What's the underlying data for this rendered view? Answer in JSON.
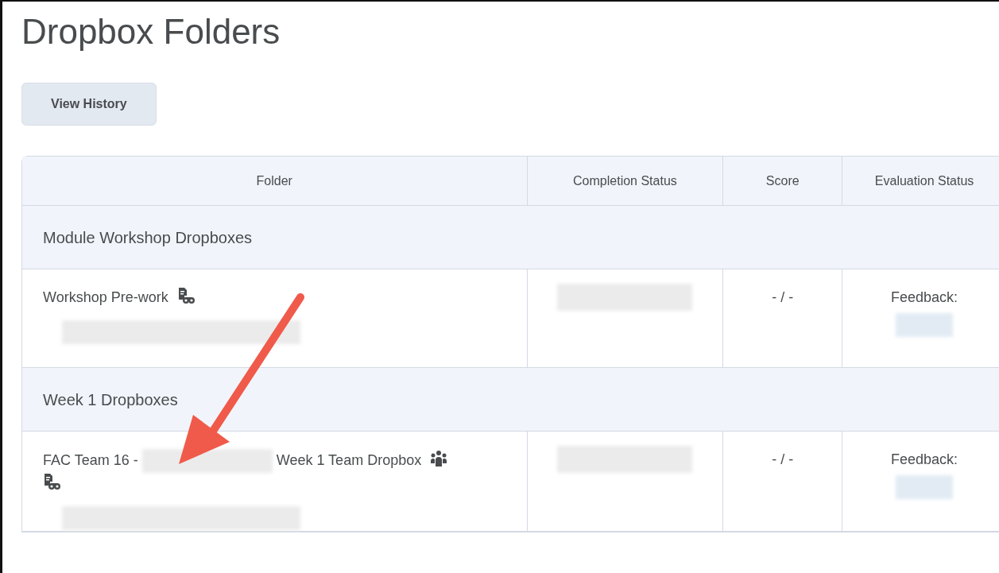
{
  "page": {
    "title": "Dropbox Folders"
  },
  "buttons": [
    {
      "label": "View History"
    }
  ],
  "table": {
    "columns": [
      "Folder",
      "Completion Status",
      "Score",
      "Evaluation Status"
    ],
    "rows": [
      {
        "kind": "group",
        "title": "Module Workshop Dropboxes"
      },
      {
        "kind": "folder",
        "name_parts": [
          {
            "kind": "text",
            "text": "Workshop Pre-work"
          }
        ],
        "group_folder": false,
        "anonymous_marking": true,
        "detail_blurred": true,
        "completion_blurred": true,
        "score": "- / -",
        "evaluation": "Feedback:",
        "feedback_blurred": true
      },
      {
        "kind": "group",
        "title": "Week 1 Dropboxes"
      },
      {
        "kind": "folder",
        "name_parts": [
          {
            "kind": "text",
            "text": "FAC Team 16 -"
          },
          {
            "kind": "blur"
          },
          {
            "kind": "text",
            "text": "Week 1 Team Dropbox"
          }
        ],
        "group_folder": true,
        "anonymous_marking": true,
        "detail_blurred": true,
        "completion_blurred": true,
        "score": "- / -",
        "evaluation": "Feedback:",
        "feedback_blurred": true
      }
    ]
  },
  "annotation_arrow": true
}
